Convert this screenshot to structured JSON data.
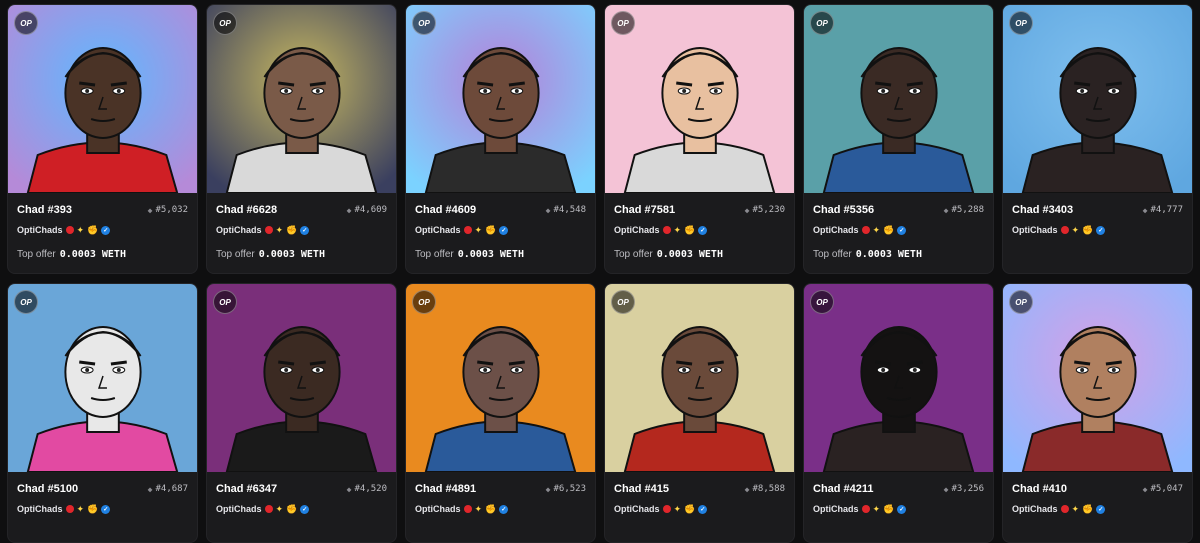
{
  "collection": "OptiChads",
  "badge": "OP",
  "offer_label": "Top offer",
  "cards": [
    {
      "name": "Chad #393",
      "rank": "#5,032",
      "offer": "0.0003 WETH",
      "bg": [
        "#b58ad8",
        "#5fb8ff"
      ],
      "skin": "#4a3326",
      "hair": "#2a2a2a",
      "shirt": "#cf1f25",
      "icon": "durag-icon"
    },
    {
      "name": "Chad #6628",
      "rank": "#4,609",
      "offer": "0.0003 WETH",
      "bg": [
        "#3a3f5f",
        "#c7b860"
      ],
      "skin": "#7a5a48",
      "hair": "#111111",
      "shirt": "#d9d9d9",
      "icon": "top-hat-icon"
    },
    {
      "name": "Chad #4609",
      "rank": "#4,548",
      "offer": "0.0003 WETH",
      "bg": [
        "#7bd2ff",
        "#b580d8"
      ],
      "skin": "#6d4a3a",
      "hair": "#3e4a2a",
      "shirt": "#2b2b2b",
      "icon": "dreadlocks-icon"
    },
    {
      "name": "Chad #7581",
      "rank": "#5,230",
      "offer": "0.0003 WETH",
      "bg": [
        "#f4c3d6",
        "#f4c3d6"
      ],
      "skin": "#e8c0a0",
      "hair": "#e6d89a",
      "shirt": "#d9d9d9",
      "icon": "blond-hair-icon"
    },
    {
      "name": "Chad #5356",
      "rank": "#5,288",
      "offer": "0.0003 WETH",
      "bg": [
        "#5aa0a8",
        "#5aa0a8"
      ],
      "skin": "#3a2a24",
      "hair": "#e6d89a",
      "shirt": "#2a5a9a",
      "icon": "knife-icon"
    },
    {
      "name": "Chad #3403",
      "rank": "#4,777",
      "offer": "",
      "bg": [
        "#5fa7e0",
        "#7fbfee"
      ],
      "skin": "#2a2222",
      "hair": "#1a1a1a",
      "shirt": "#2a2222",
      "icon": "headphones-icon"
    },
    {
      "name": "Chad #5100",
      "rank": "#4,687",
      "offer": "",
      "bg": [
        "#6aa6d8",
        "#6aa6d8"
      ],
      "skin": "#e8e8e8",
      "hair": "#1c1c1c",
      "shirt": "#e24aa2",
      "icon": "clown-icon"
    },
    {
      "name": "Chad #6347",
      "rank": "#4,520",
      "offer": "",
      "bg": [
        "#7a2f7a",
        "#7a2f7a"
      ],
      "skin": "#3b2a22",
      "hair": "#7b7a2a",
      "shirt": "#1a1a1a",
      "icon": "laser-eyes-icon"
    },
    {
      "name": "Chad #4891",
      "rank": "#6,523",
      "offer": "",
      "bg": [
        "#e98a1f",
        "#e98a1f"
      ],
      "skin": "#6c5048",
      "hair": "#f29ad7",
      "shirt": "#2a5a9a",
      "icon": "pink-hair-icon"
    },
    {
      "name": "Chad #415",
      "rank": "#8,588",
      "offer": "",
      "bg": [
        "#d9d0a0",
        "#d9d0a0"
      ],
      "skin": "#6a4a3a",
      "hair": "#1a1a1a",
      "shirt": "#b4281e",
      "icon": "lava-shirt-icon"
    },
    {
      "name": "Chad #4211",
      "rank": "#3,256",
      "offer": "",
      "bg": [
        "#7a2f88",
        "#7a2f88"
      ],
      "skin": "#141212",
      "hair": "#141212",
      "shirt": "#2a2222",
      "icon": "beard-icon"
    },
    {
      "name": "Chad #410",
      "rank": "#5,047",
      "offer": "",
      "bg": [
        "#8fb8ff",
        "#d4a0e6"
      ],
      "skin": "#b08060",
      "hair": "#b08060",
      "shirt": "#8a2a2a",
      "icon": "pizza-icon"
    }
  ]
}
